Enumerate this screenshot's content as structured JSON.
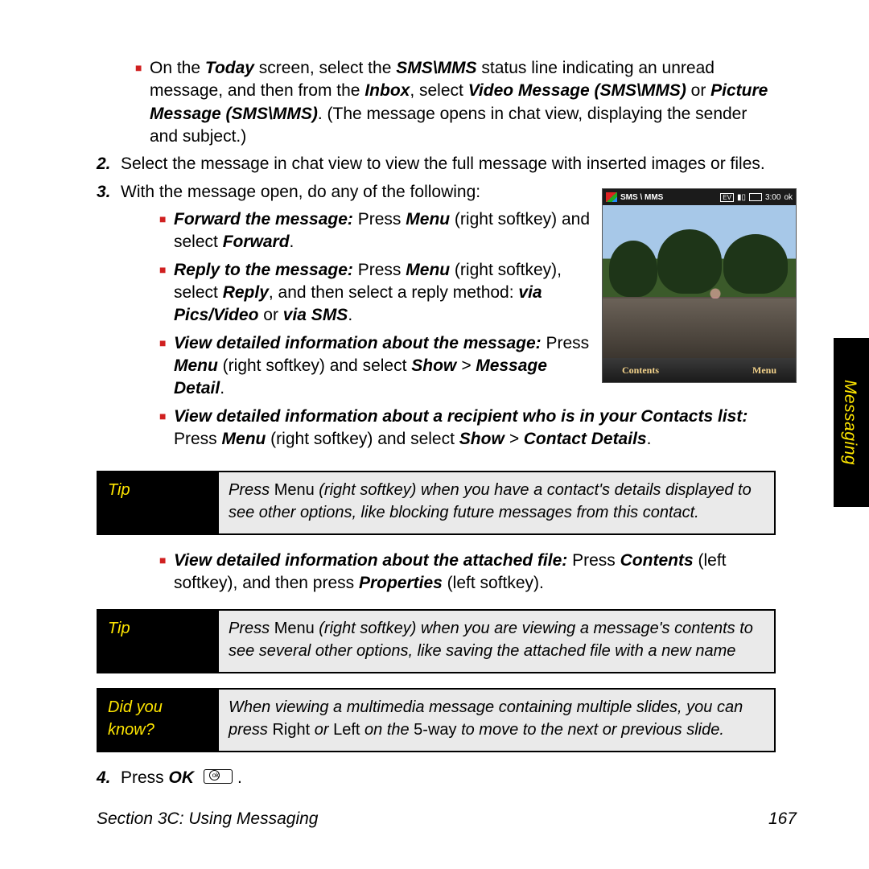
{
  "side_tab": "Messaging",
  "bullet_intro": {
    "t1": "On the ",
    "b1": "Today",
    "t2": " screen, select the ",
    "b2": "SMS\\MMS",
    "t3": " status line indicating an unread message, and then from the ",
    "b3": "Inbox",
    "t4": ", select ",
    "b4": "Video Message (SMS\\MMS)",
    "t5": " or ",
    "b5": "Picture Message (SMS\\MMS)",
    "t6": ". (The message opens in chat view, displaying the sender and subject.)"
  },
  "step2": {
    "num": "2.",
    "text": "Select the message in chat view to view the full message with inserted images or files."
  },
  "step3": {
    "num": "3.",
    "text": "With the message open, do any of the following:",
    "b1": {
      "bi": "Forward the message:",
      "t1": " Press ",
      "b1": "Menu",
      "t2": " (right softkey) and select ",
      "b2": "Forward",
      "t3": "."
    },
    "b2": {
      "bi": "Reply to the message:",
      "t1": " Press ",
      "b1": "Menu",
      "t2": " (right softkey), select ",
      "b2": "Reply",
      "t3": ", and then select a reply method: ",
      "bi2": "via Pics/Video",
      "t4": " or ",
      "bi3": "via SMS",
      "t5": "."
    },
    "b3": {
      "bi": "View detailed information about the message:",
      "t1": " Press ",
      "b1": "Menu",
      "t2": " (right softkey) and select ",
      "b2": "Show",
      "gt": " > ",
      "b3": "Message Detail",
      "t3": "."
    },
    "b4": {
      "bi": "View detailed information about a recipient who is in your Contacts list:",
      "t1": " Press ",
      "b1": "Menu",
      "t2": " (right softkey) and select ",
      "b2": "Show",
      "gt": " > ",
      "b3": "Contact Details",
      "t3": "."
    }
  },
  "tip1": {
    "label": "Tip",
    "t1": "Press ",
    "nb": "Menu",
    "t2": " (right softkey) when you have a contact's details displayed to see other options, like blocking future messages from this contact."
  },
  "step3b5": {
    "bi": "View detailed information about the attached file:",
    "t1": " Press ",
    "b1": "Contents",
    "t2": " (left softkey), and then press ",
    "b2": "Properties",
    "t3": " (left softkey)."
  },
  "tip2": {
    "label": "Tip",
    "t1": "Press ",
    "nb": "Menu",
    "t2": " (right softkey) when you are viewing a message's contents to see several other options, like saving the attached file with a new name"
  },
  "dyk": {
    "label": "Did you know?",
    "t1": "When viewing a multimedia message containing multiple slides, you can press ",
    "nb1": "Right",
    "t2": " or ",
    "nb2": "Left",
    "t3": " on the ",
    "nb3": "5-way",
    "t4": " to move to the next or previous slide."
  },
  "step4": {
    "num": "4.",
    "t1": "Press ",
    "b1": "OK",
    "ok": "ok",
    "t2": " ."
  },
  "phone": {
    "title": "SMS \\ MMS",
    "ev": "EV",
    "time": "3:00",
    "ok": "ok",
    "left": "Contents",
    "right": "Menu"
  },
  "footer": {
    "left": "Section 3C: Using Messaging",
    "right": "167"
  }
}
